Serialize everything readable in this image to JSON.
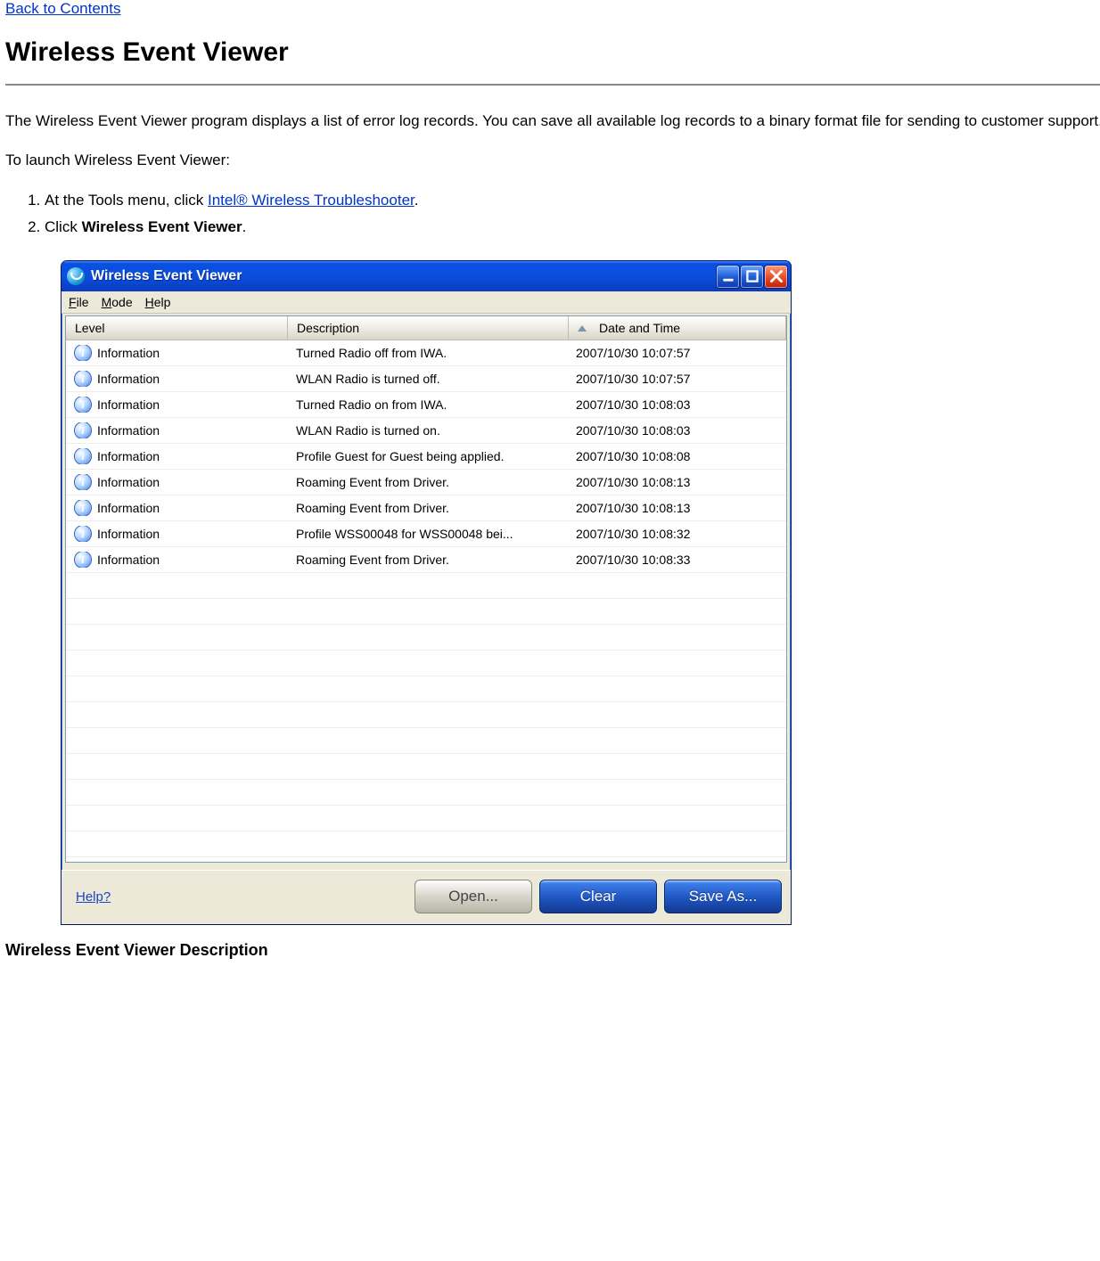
{
  "doc": {
    "back_link": "Back to Contents",
    "heading": "Wireless Event Viewer",
    "intro": "The Wireless Event Viewer program displays a list of error log records. You can save all available log records to a binary format file for sending to customer support.",
    "launch_lead": "To launch Wireless Event Viewer:",
    "step1_pre": "At the Tools menu, click ",
    "step1_link": "Intel® Wireless Troubleshooter",
    "step1_post": ".",
    "step2_pre": "Click ",
    "step2_bold": "Wireless Event Viewer",
    "step2_post": ".",
    "section_desc": "Wireless Event Viewer Description"
  },
  "window": {
    "title": "Wireless Event Viewer",
    "menu": {
      "file": "File",
      "mode": "Mode",
      "help": "Help"
    },
    "columns": {
      "level": "Level",
      "description": "Description",
      "date": "Date and Time"
    },
    "rows": [
      {
        "level": "Information",
        "desc": "Turned Radio off from IWA.",
        "date": "2007/10/30 10:07:57"
      },
      {
        "level": "Information",
        "desc": "WLAN Radio is turned off.",
        "date": "2007/10/30 10:07:57"
      },
      {
        "level": "Information",
        "desc": "Turned Radio on from IWA.",
        "date": "2007/10/30 10:08:03"
      },
      {
        "level": "Information",
        "desc": "WLAN Radio is turned on.",
        "date": "2007/10/30 10:08:03"
      },
      {
        "level": "Information",
        "desc": "Profile Guest for Guest being applied.",
        "date": "2007/10/30 10:08:08"
      },
      {
        "level": "Information",
        "desc": "Roaming Event from Driver.",
        "date": "2007/10/30 10:08:13"
      },
      {
        "level": "Information",
        "desc": "Roaming Event from Driver.",
        "date": "2007/10/30 10:08:13"
      },
      {
        "level": "Information",
        "desc": "Profile WSS00048 for WSS00048 bei...",
        "date": "2007/10/30 10:08:32"
      },
      {
        "level": "Information",
        "desc": "Roaming Event from Driver.",
        "date": "2007/10/30 10:08:33"
      }
    ],
    "footer": {
      "help": "Help?",
      "open": "Open...",
      "clear": "Clear",
      "save": "Save As..."
    }
  }
}
